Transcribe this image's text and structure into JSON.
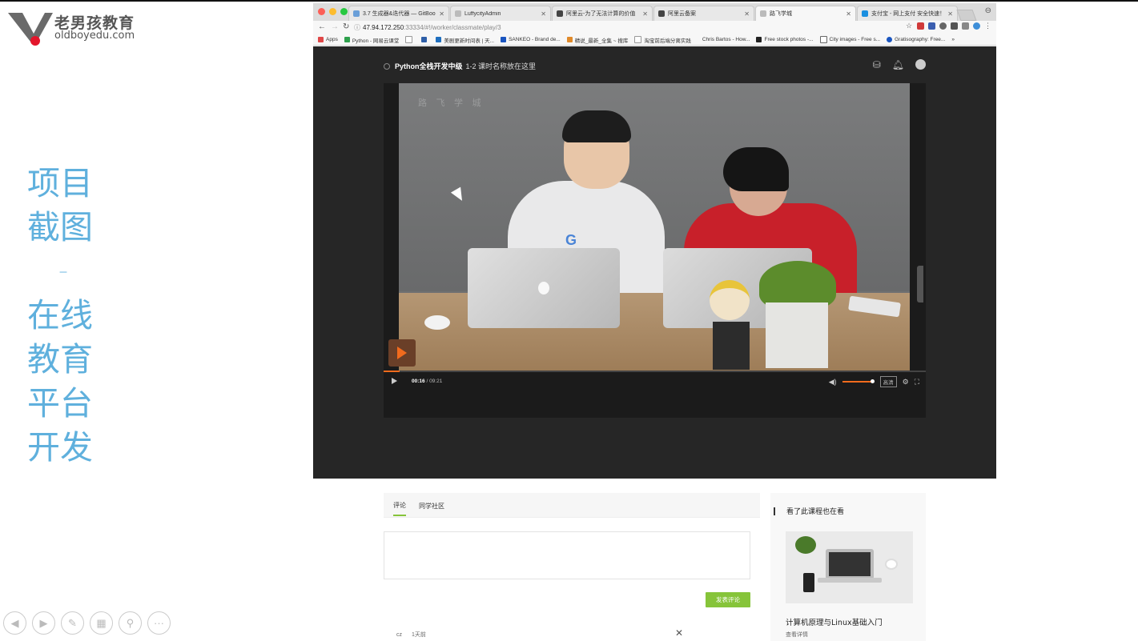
{
  "slide": {
    "logo_cn": "老男孩教育",
    "logo_en": "oldboyedu.com",
    "title_lines": [
      "项目",
      "截图",
      "–",
      "在线",
      "教育",
      "平台",
      "开发"
    ],
    "accent_color": "#5fb0dd",
    "controls": [
      "prev-icon",
      "next-icon",
      "pen-icon",
      "slides-icon",
      "zoom-icon",
      "more-icon"
    ]
  },
  "browser": {
    "tabs": [
      {
        "title": "3.7 生成器&迭代器 — GitBoo",
        "active": false
      },
      {
        "title": "LuffycityAdmin",
        "active": false
      },
      {
        "title": "阿里云-为了无法计算的价值",
        "active": false
      },
      {
        "title": "阿里云备案",
        "active": false
      },
      {
        "title": "路飞学城",
        "active": true
      },
      {
        "title": "支付宝 - 网上支付 安全快速！",
        "active": false
      }
    ],
    "url_host": "47.94.172.250",
    "url_rest": ":33334/#!/worker/classmate/play/3",
    "bookmarks": [
      "Apps",
      "Python - 网易云课堂",
      "",
      "",
      "美剧更新时间表 | 天...",
      "SANKEO - Brand de...",
      "精说_最新_全集 ~ 搜库",
      "淘宝前后端分离实践",
      "Chris Bartos - How...",
      "Free stock photos -...",
      "City images - Free s...",
      "Gratisography: Free..."
    ],
    "bookmarks_more": "»"
  },
  "page": {
    "course_title": "Python全栈开发中级",
    "lesson_title": "1-2 课时名称放在这里",
    "player": {
      "watermark": "路 飞 学 城",
      "current_time": "00:16",
      "time_separator": "/",
      "duration": "09:21",
      "progress_fraction": 0.03,
      "volume_fraction": 0.95,
      "quality": "高清",
      "accent_color": "#f26b1d"
    },
    "tabs": [
      "评论",
      "同学社区"
    ],
    "post_button": "发表评论",
    "post_button_color": "#86c43a",
    "comment": {
      "user": "cz",
      "time": "1天前",
      "close": "✕"
    },
    "related": {
      "title": "看了此课程也在看",
      "course": "计算机原理与Linux基础入门",
      "link": "查看详情"
    }
  }
}
